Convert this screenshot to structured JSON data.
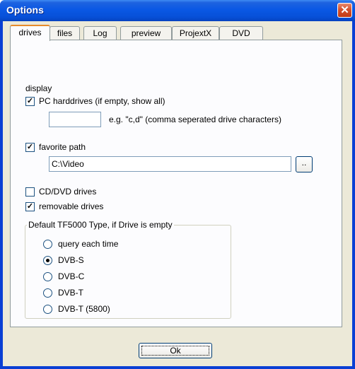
{
  "window": {
    "title": "Options",
    "close_glyph": "✕"
  },
  "tabs": [
    {
      "label": "drives",
      "active": true
    },
    {
      "label": "files",
      "active": false
    },
    {
      "label": "Log",
      "active": false
    },
    {
      "label": "preview",
      "active": false
    },
    {
      "label": "ProjextX",
      "active": false
    },
    {
      "label": "DVD",
      "active": false
    }
  ],
  "display": {
    "heading": "display",
    "pc_harddrives": {
      "label": "PC harddrives (if empty, show all)",
      "checked": true,
      "value": "",
      "hint": "e.g. \"c,d\" (comma seperated drive characters)"
    },
    "favorite_path": {
      "label": "favorite path",
      "checked": true,
      "value": "C:\\Video",
      "browse_label": ".."
    },
    "cd_dvd_drives": {
      "label": "CD/DVD drives",
      "checked": false
    },
    "removable_drives": {
      "label": "removable drives",
      "checked": true
    }
  },
  "default_type": {
    "title": "Default TF5000 Type, if Drive is empty",
    "options": [
      {
        "label": "query each time",
        "selected": false
      },
      {
        "label": "DVB-S",
        "selected": true
      },
      {
        "label": "DVB-C",
        "selected": false
      },
      {
        "label": "DVB-T",
        "selected": false
      },
      {
        "label": "DVB-T (5800)",
        "selected": false
      }
    ]
  },
  "ok_button": {
    "label": "Ok"
  },
  "colors": {
    "title_bar": "#0a58e4",
    "dialog_bg": "#ece9d8",
    "tab_accent": "#e68b2c",
    "check_green": "#21a121"
  },
  "icons": {
    "check": "checkmark-icon",
    "close": "close-icon"
  }
}
